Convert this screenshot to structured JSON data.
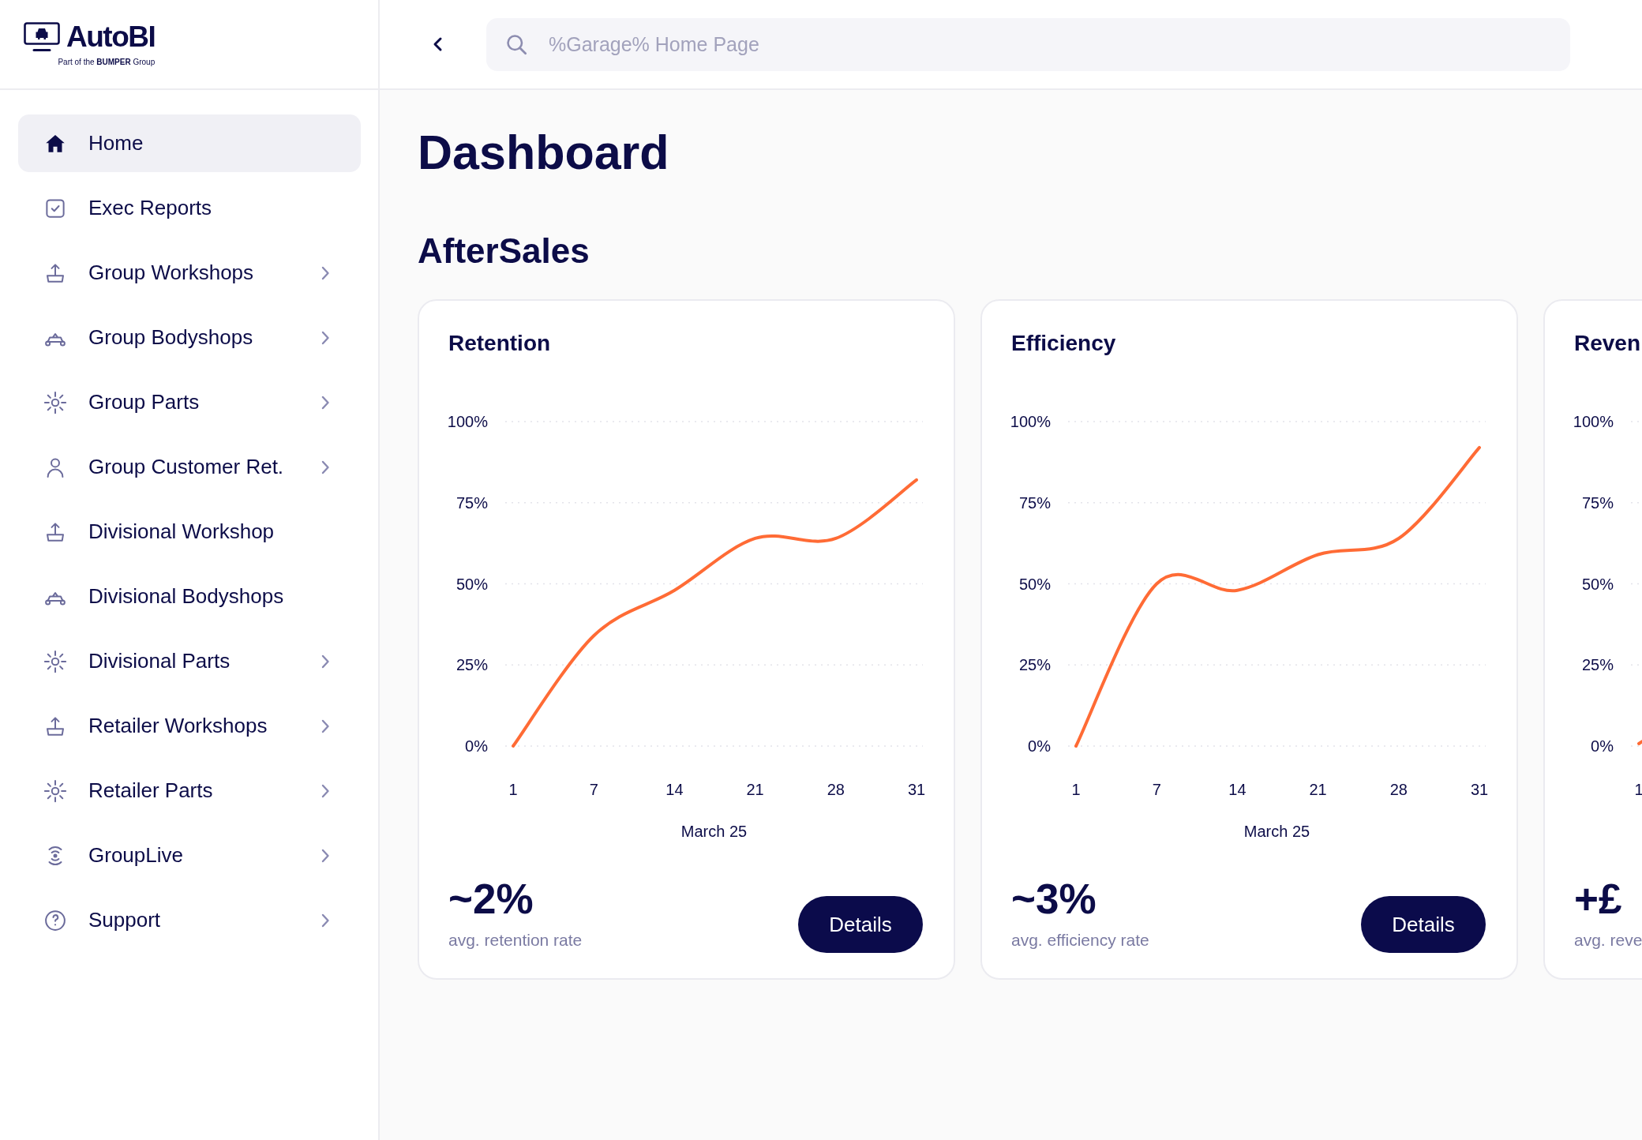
{
  "logo": {
    "name": "AutoBI",
    "tagline": "Part of the **BUMPER** Group"
  },
  "search": {
    "placeholder": "%Garage% Home Page"
  },
  "sidebar": {
    "items": [
      {
        "label": "Home",
        "selected": true,
        "has_submenu": false
      },
      {
        "label": "Exec Reports",
        "selected": false,
        "has_submenu": false
      },
      {
        "label": "Group Workshops",
        "selected": false,
        "has_submenu": true
      },
      {
        "label": "Group Bodyshops",
        "selected": false,
        "has_submenu": true
      },
      {
        "label": "Group Parts",
        "selected": false,
        "has_submenu": true
      },
      {
        "label": "Group Customer Ret.",
        "selected": false,
        "has_submenu": true
      },
      {
        "label": "Divisional Workshop",
        "selected": false,
        "has_submenu": false
      },
      {
        "label": "Divisional Bodyshops",
        "selected": false,
        "has_submenu": false
      },
      {
        "label": "Divisional Parts",
        "selected": false,
        "has_submenu": true
      },
      {
        "label": "Retailer Workshops",
        "selected": false,
        "has_submenu": true
      },
      {
        "label": "Retailer Parts",
        "selected": false,
        "has_submenu": true
      },
      {
        "label": "GroupLive",
        "selected": false,
        "has_submenu": true
      },
      {
        "label": "Support",
        "selected": false,
        "has_submenu": true
      }
    ]
  },
  "page": {
    "title": "Dashboard",
    "section": "AfterSales"
  },
  "cards": [
    {
      "title": "Retention",
      "chart_data": {
        "type": "line",
        "categories": [
          "1",
          "7",
          "14",
          "21",
          "28",
          "31"
        ],
        "values": [
          0,
          34,
          48,
          64,
          64,
          82
        ],
        "color": "#ff6b35",
        "xlabel": "March 25",
        "ylim": [
          0,
          100
        ],
        "yticks": [
          {
            "value": 0,
            "label": "0%"
          },
          {
            "value": 25,
            "label": "25%"
          },
          {
            "value": 50,
            "label": "50%"
          },
          {
            "value": 75,
            "label": "75%"
          },
          {
            "value": 100,
            "label": "100%"
          }
        ],
        "grid": true
      },
      "stat": "~2%",
      "stat_label": "avg. retention rate",
      "button": "Details"
    },
    {
      "title": "Efficiency",
      "chart_data": {
        "type": "line",
        "categories": [
          "1",
          "7",
          "14",
          "21",
          "28",
          "31"
        ],
        "values": [
          0,
          50,
          48,
          59,
          64,
          92
        ],
        "color": "#ff6b35",
        "xlabel": "March 25",
        "ylim": [
          0,
          100
        ],
        "yticks": [
          {
            "value": 0,
            "label": "0%"
          },
          {
            "value": 25,
            "label": "25%"
          },
          {
            "value": 50,
            "label": "50%"
          },
          {
            "value": 75,
            "label": "75%"
          },
          {
            "value": 100,
            "label": "100%"
          }
        ],
        "grid": true
      },
      "stat": "~3%",
      "stat_label": "avg. efficiency rate",
      "button": "Details"
    },
    {
      "title": "Reven",
      "chart_labels": {
        "y_labels": [
          "100%",
          "75%",
          "50%",
          "25%",
          "0%"
        ],
        "x_labels": [
          "1"
        ]
      },
      "stat": "+£",
      "stat_label": "avg. reve"
    }
  ]
}
